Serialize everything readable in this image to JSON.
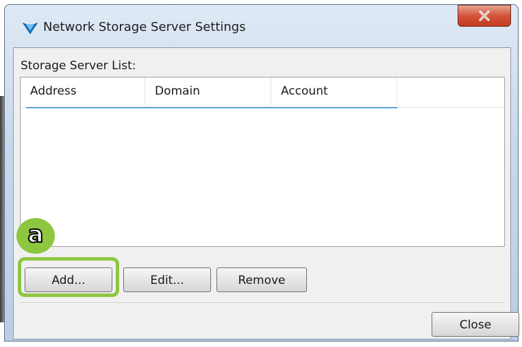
{
  "window": {
    "title": "Network Storage Server Settings",
    "close_icon": "close-icon"
  },
  "storage_list": {
    "label": "Storage Server List:",
    "columns": [
      "Address",
      "Domain",
      "Account"
    ],
    "rows": []
  },
  "buttons": {
    "add": "Add...",
    "edit": "Edit...",
    "remove": "Remove",
    "close": "Close"
  },
  "annotation": {
    "letter": "a",
    "color": "#8dc63f"
  }
}
